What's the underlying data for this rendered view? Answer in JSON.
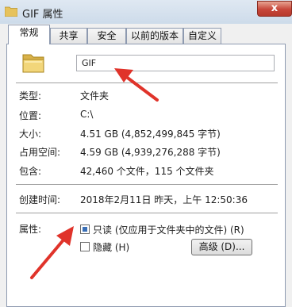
{
  "window": {
    "title": "GIF 属性",
    "close_label": "x"
  },
  "tabs": [
    {
      "label": "常规",
      "active": true
    },
    {
      "label": "共享",
      "active": false
    },
    {
      "label": "安全",
      "active": false
    },
    {
      "label": "以前的版本",
      "active": false
    },
    {
      "label": "自定义",
      "active": false
    }
  ],
  "general": {
    "name_value": "GIF",
    "type_label": "类型:",
    "type_value": "文件夹",
    "location_label": "位置:",
    "location_value": "C:\\",
    "size_label": "大小:",
    "size_value": "4.51 GB (4,852,499,845 字节)",
    "size_on_disk_label": "占用空间:",
    "size_on_disk_value": "4.59 GB (4,939,276,288 字节)",
    "contains_label": "包含:",
    "contains_value": "42,460 个文件，115 个文件夹",
    "created_label": "创建时间:",
    "created_value": "2018年2月11日 昨天，上午 12:50:36",
    "attributes_label": "属性:",
    "readonly_label": "只读 (仅应用于文件夹中的文件) (R)",
    "readonly_state": "indeterminate",
    "hidden_label": "隐藏 (H)",
    "hidden_checked": false,
    "advanced_label": "高级 (D)..."
  },
  "icons": {
    "folder": "folder-icon",
    "app": "folder-icon"
  },
  "colors": {
    "arrow": "#e0332a",
    "close_button": "#c7463a",
    "checkbox_fill": "#3a6fb6"
  }
}
